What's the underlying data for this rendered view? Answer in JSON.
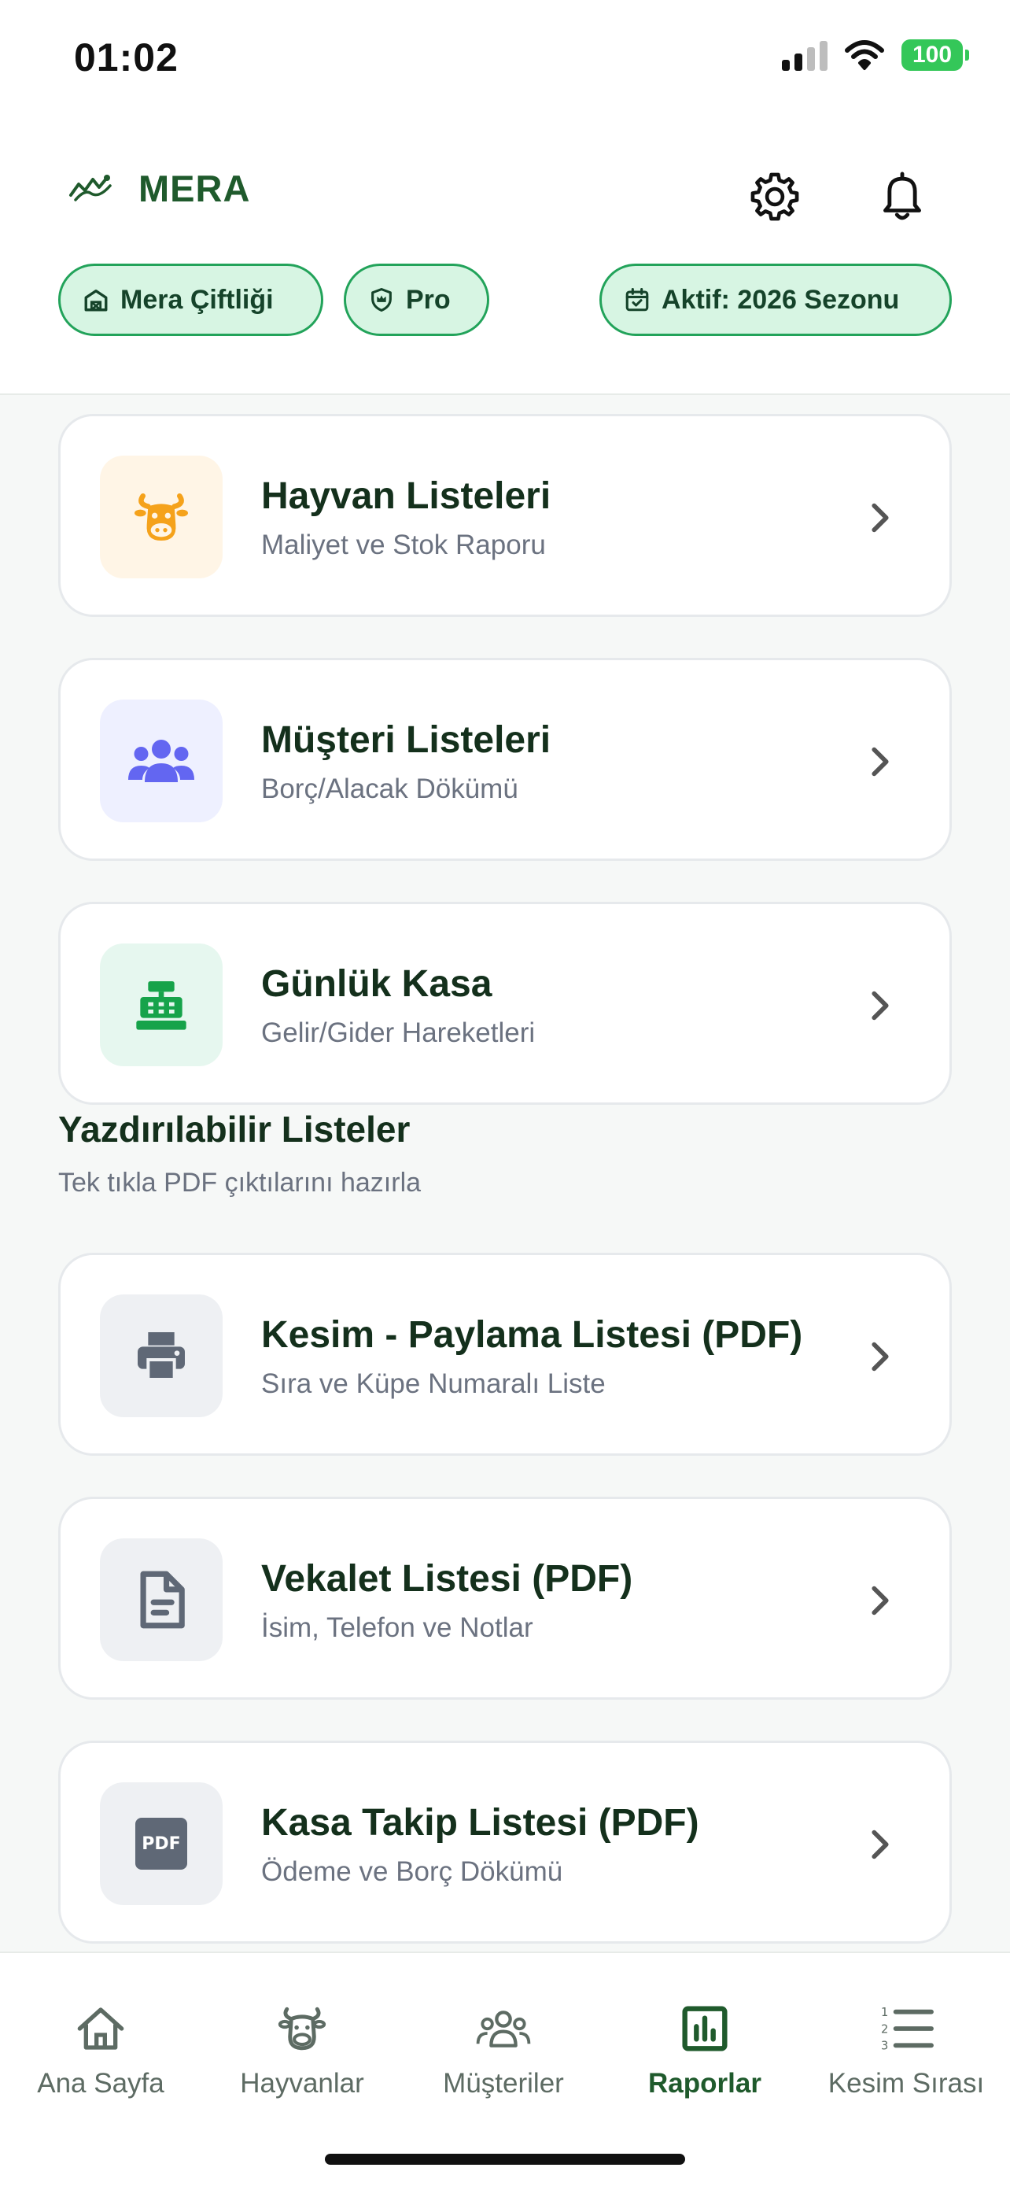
{
  "status_bar": {
    "time": "01:02",
    "battery": "100"
  },
  "header": {
    "app_title": "MERA",
    "chips": {
      "farm": "Mera Çiftliği",
      "plan": "Pro",
      "season": "Aktif: 2026 Sezonu"
    }
  },
  "reports": [
    {
      "title": "Hayvan Listeleri",
      "subtitle": "Maliyet ve Stok Raporu",
      "icon": "cow-icon"
    },
    {
      "title": "Müşteri Listeleri",
      "subtitle": "Borç/Alacak Dökümü",
      "icon": "users-icon"
    },
    {
      "title": "Günlük Kasa",
      "subtitle": "Gelir/Gider Hareketleri",
      "icon": "cash-register-icon"
    }
  ],
  "printable_section": {
    "title": "Yazdırılabilir Listeler",
    "subtitle": "Tek tıkla PDF çıktılarını hazırla",
    "items": [
      {
        "title": "Kesim - Paylama Listesi (PDF)",
        "subtitle": "Sıra ve Küpe Numaralı Liste",
        "icon": "printer-icon"
      },
      {
        "title": "Vekalet Listesi (PDF)",
        "subtitle": "İsim, Telefon ve Notlar",
        "icon": "document-icon"
      },
      {
        "title": "Kasa Takip Listesi (PDF)",
        "subtitle": "Ödeme ve Borç Dökümü",
        "icon": "pdf-icon",
        "icon_text": "PDF"
      }
    ]
  },
  "tab_bar": {
    "active": "Raporlar",
    "tabs": [
      {
        "label": "Ana Sayfa",
        "icon": "home-icon"
      },
      {
        "label": "Hayvanlar",
        "icon": "cow-icon"
      },
      {
        "label": "Müşteriler",
        "icon": "users-icon"
      },
      {
        "label": "Raporlar",
        "icon": "bar-chart-icon"
      },
      {
        "label": "Kesim Sırası",
        "icon": "numbered-list-icon"
      }
    ]
  },
  "colors": {
    "brand_green": "#1f5a2c",
    "chip_border": "#22a35a",
    "chip_bg": "#d7f5e3",
    "cow_orange": "#f5a21b",
    "users_purple": "#6366f1",
    "cash_green": "#16a34a",
    "gray_icon": "#5f6876"
  }
}
